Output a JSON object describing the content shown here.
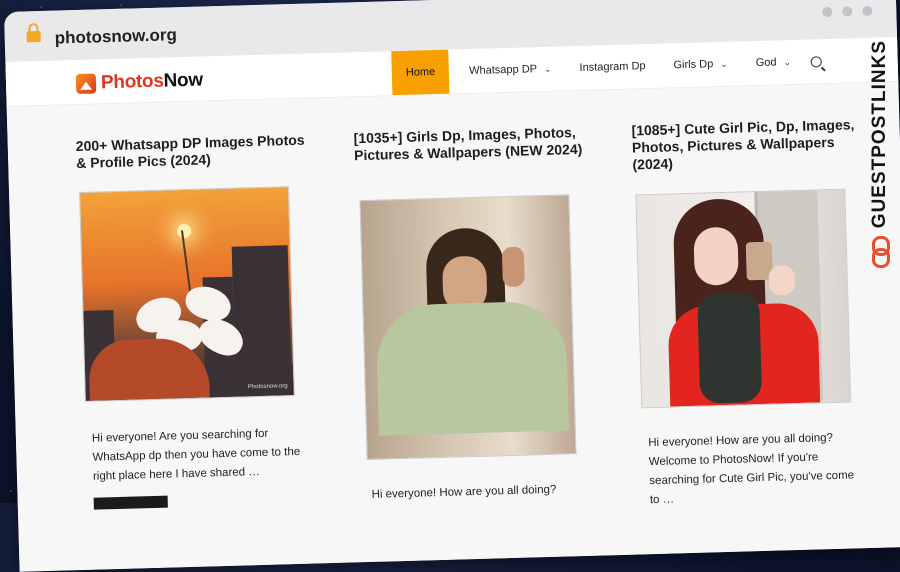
{
  "browser": {
    "url": "photosnow.org"
  },
  "site": {
    "logo_part1": "Photos",
    "logo_part2": "Now"
  },
  "nav": {
    "items": [
      {
        "label": "Home",
        "active": true
      },
      {
        "label": "Whatsapp DP",
        "has_dropdown": true
      },
      {
        "label": "Instagram Dp",
        "has_dropdown": false
      },
      {
        "label": "Girls Dp",
        "has_dropdown": true
      },
      {
        "label": "God",
        "has_dropdown": true
      }
    ]
  },
  "posts": [
    {
      "title": "200+ Whatsapp DP Images Photos & Profile Pics (2024)",
      "excerpt": "Hi everyone! Are you searching for WhatsApp dp then you have come to the right place here I have shared …",
      "watermark": "Photosnow.org"
    },
    {
      "title": "[1035+] Girls Dp, Images, Photos, Pictures & Wallpapers (NEW 2024)",
      "excerpt": "Hi everyone! How are you all doing?"
    },
    {
      "title": "[1085+] Cute Girl Pic, Dp, Images, Photos, Pictures & Wallpapers (2024)",
      "excerpt": "Hi everyone! How are you all doing? Welcome to PhotosNow! If you're searching for Cute Girl Pic, you've come to …"
    }
  ],
  "badge": {
    "text": "GUESTPOSTLINKS"
  },
  "colors": {
    "accent": "#f7a000",
    "logo_red": "#e0341f",
    "badge_orange": "#e8502c"
  }
}
